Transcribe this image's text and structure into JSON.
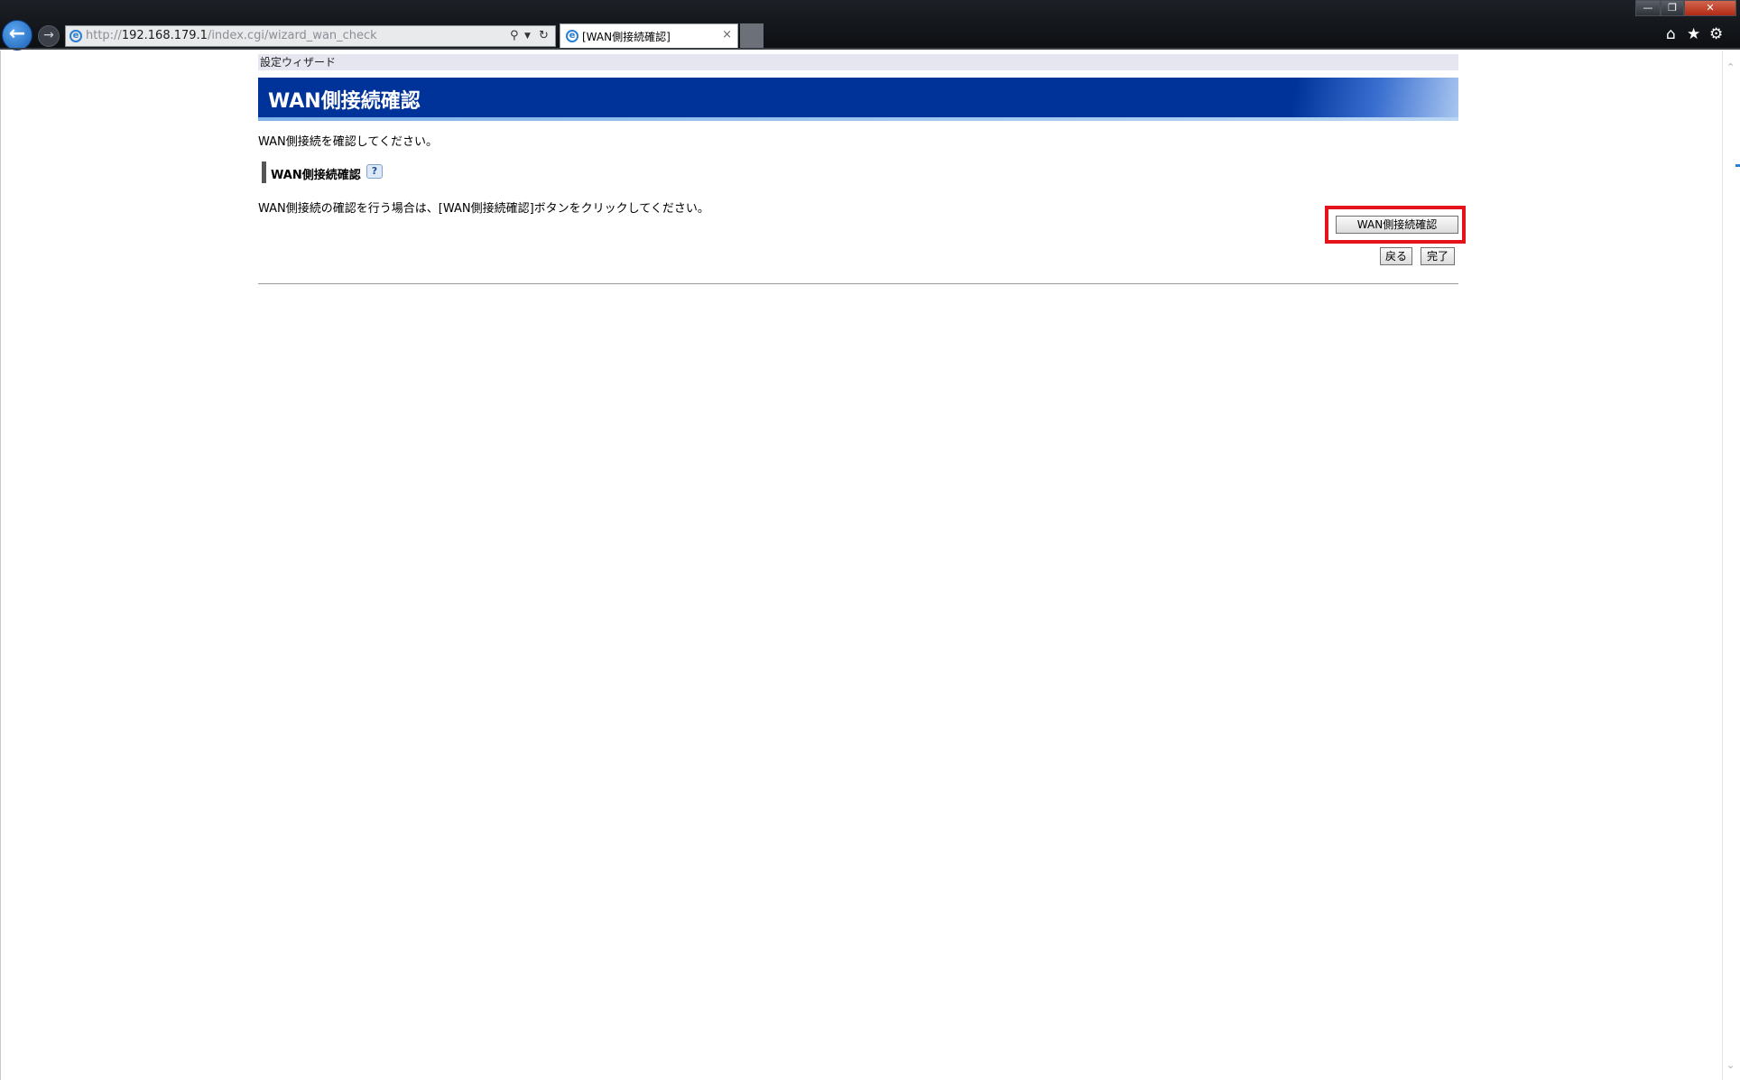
{
  "browser": {
    "address": {
      "prefix": "http://",
      "host": "192.168.179.1",
      "path": "/index.cgi/wizard_wan_check"
    },
    "tab_title": "[WAN側接続確認]",
    "tab_close": "×",
    "toolbar_icons": [
      "home-icon",
      "star-icon",
      "gear-icon"
    ]
  },
  "page": {
    "breadcrumb": "設定ウィザード",
    "title": "WAN側接続確認",
    "intro": "WAN側接続を確認してください。",
    "section_label": "WAN側接続確認",
    "help_label": "?",
    "instruction": "WAN側接続の確認を行う場合は、[WAN側接続確認]ボタンをクリックしてください。",
    "check_button": "WAN側接続確認",
    "back_button": "戻る",
    "done_button": "完了"
  },
  "colors": {
    "title_bar": "#003399",
    "highlight_box": "#e3121b",
    "crumb_bg": "#e6e6f0"
  }
}
